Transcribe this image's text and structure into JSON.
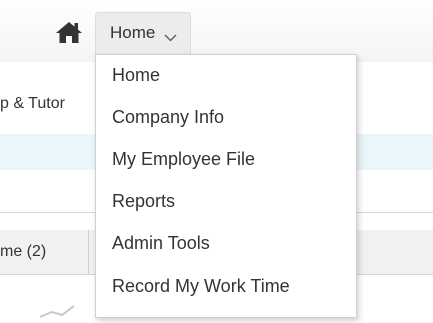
{
  "nav": {
    "home_button_label": "Home",
    "dropdown_items": [
      "Home",
      "Company Info",
      "My Employee File",
      "Reports",
      "Admin Tools",
      "Record My Work Time"
    ]
  },
  "background": {
    "tutor_text": "p & Tutor",
    "tab_time_label": "me (2)"
  },
  "icons": {
    "home": "home-icon",
    "chevron": "chevron-down-icon"
  },
  "colors": {
    "text": "#333333",
    "button_bg": "#ececec",
    "band_bg": "#eaf7fa",
    "icon": "#333333"
  }
}
